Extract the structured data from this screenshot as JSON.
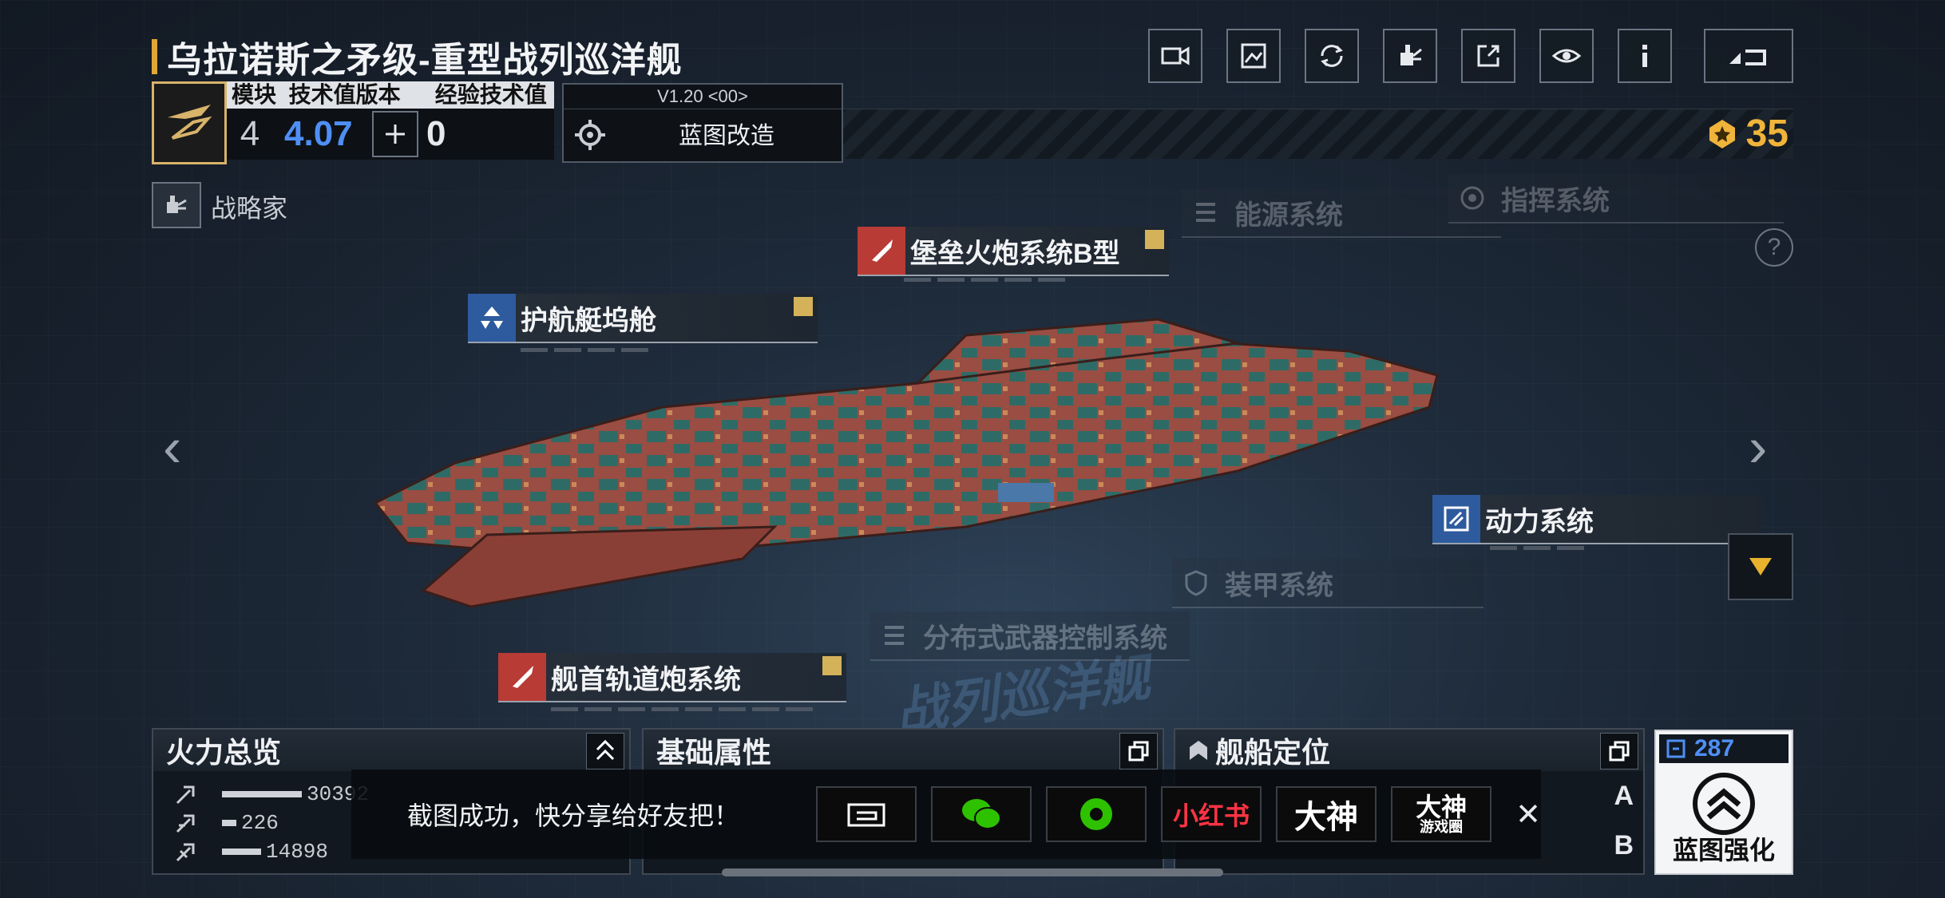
{
  "header": {
    "title": "乌拉诺斯之矛级-重型战列巡洋舰",
    "tools": [
      "video-icon",
      "gallery-icon",
      "rotate-icon",
      "crane-icon",
      "share-out-icon",
      "view-eye-icon",
      "info-icon",
      "back-icon"
    ]
  },
  "info": {
    "col1": "模块",
    "col2": "技术值版本",
    "col3": "经验技术值",
    "module_count": "4",
    "tech_value": "4.07",
    "exp_tech_value": "0"
  },
  "blueprint": {
    "version": "V1.20 <00>",
    "label": "蓝图改造"
  },
  "currency": {
    "value": "35",
    "icon": "badge-icon",
    "color": "#f0b43a"
  },
  "role": {
    "label": "战略家"
  },
  "modules": {
    "fortress_gun": "堡垒火炮系统B型",
    "escort_hangar": "护航艇坞舱",
    "power_system": "动力系统",
    "bow_railgun": "舰首轨道炮系统",
    "energy_system": "能源系统",
    "command_system": "指挥系统",
    "armor_system": "装甲系统",
    "distributed_control": "分布式武器控制系统"
  },
  "watermark": "战列巡洋舰",
  "panels": {
    "firepower": {
      "title": "火力总览",
      "rows": [
        {
          "icon": "anti-ship-icon",
          "value": "30392",
          "fraction": 1.0
        },
        {
          "icon": "anti-air-icon",
          "value": "226",
          "fraction": 0.18
        },
        {
          "icon": "siege-icon",
          "value": "14898",
          "fraction": 0.49
        }
      ]
    },
    "base_attrs": {
      "title": "基础属性"
    },
    "positioning": {
      "title": "舰船定位",
      "grade_a": "A",
      "grade_b": "B"
    }
  },
  "enhance": {
    "value": "287",
    "label": "蓝图强化"
  },
  "toast": {
    "text": "截图成功，快分享给好友把！",
    "xiaohongshu": "小红书",
    "dashen": "大神",
    "dashen_circle_top": "大神",
    "dashen_circle_bottom": "游戏圈",
    "close": "✕"
  },
  "colors": {
    "accent": "#e0a636",
    "tech_blue": "#4f8ff5"
  }
}
